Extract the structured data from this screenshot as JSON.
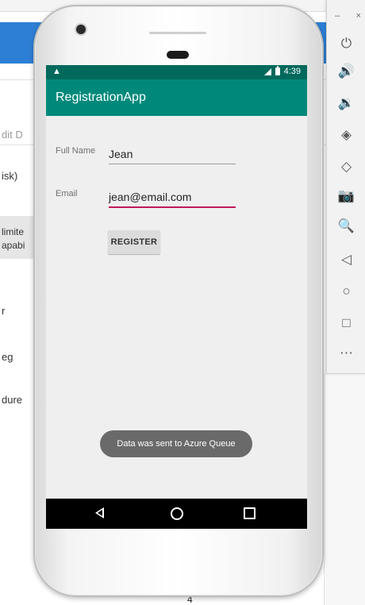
{
  "background": {
    "snippets": [
      "dit D",
      "isk)",
      "limite",
      "apabi",
      "r",
      "eg",
      "dure"
    ],
    "bottom_number": "4"
  },
  "phone": {
    "status_bar": {
      "time": "4:39",
      "warning_icon": "warning-triangle-icon"
    },
    "app_bar": {
      "title": "RegistrationApp"
    },
    "form": {
      "full_name_label": "Full Name",
      "full_name_value": "Jean",
      "email_label": "Email",
      "email_value": "jean@email.com",
      "register_button": "REGISTER"
    },
    "toast": "Data was sent to Azure Queue",
    "nav_bar": [
      "back-icon",
      "home-icon",
      "recents-icon"
    ]
  },
  "emulator_toolbar": {
    "window_controls": [
      "–",
      "×"
    ],
    "buttons": [
      {
        "name": "power",
        "icon": "power-icon",
        "glyph": "⏻"
      },
      {
        "name": "volume-up",
        "icon": "volume-up-icon",
        "glyph": "🔊"
      },
      {
        "name": "volume-down",
        "icon": "volume-down-icon",
        "glyph": "🔉"
      },
      {
        "name": "rotate-left",
        "icon": "rotate-left-icon",
        "glyph": "◈"
      },
      {
        "name": "rotate-right",
        "icon": "rotate-right-icon",
        "glyph": "◇"
      },
      {
        "name": "screenshot",
        "icon": "camera-icon",
        "glyph": "📷"
      },
      {
        "name": "zoom",
        "icon": "zoom-in-icon",
        "glyph": "🔍"
      },
      {
        "name": "back",
        "icon": "back-icon",
        "glyph": "◁"
      },
      {
        "name": "home",
        "icon": "home-icon",
        "glyph": "○"
      },
      {
        "name": "overview",
        "icon": "overview-icon",
        "glyph": "□"
      },
      {
        "name": "more",
        "icon": "more-icon",
        "glyph": "⋯"
      }
    ]
  },
  "colors": {
    "status_bar": "#00695c",
    "app_bar": "#00897b",
    "email_underline": "#c2185b",
    "ide_blue": "#2d7fd6"
  }
}
